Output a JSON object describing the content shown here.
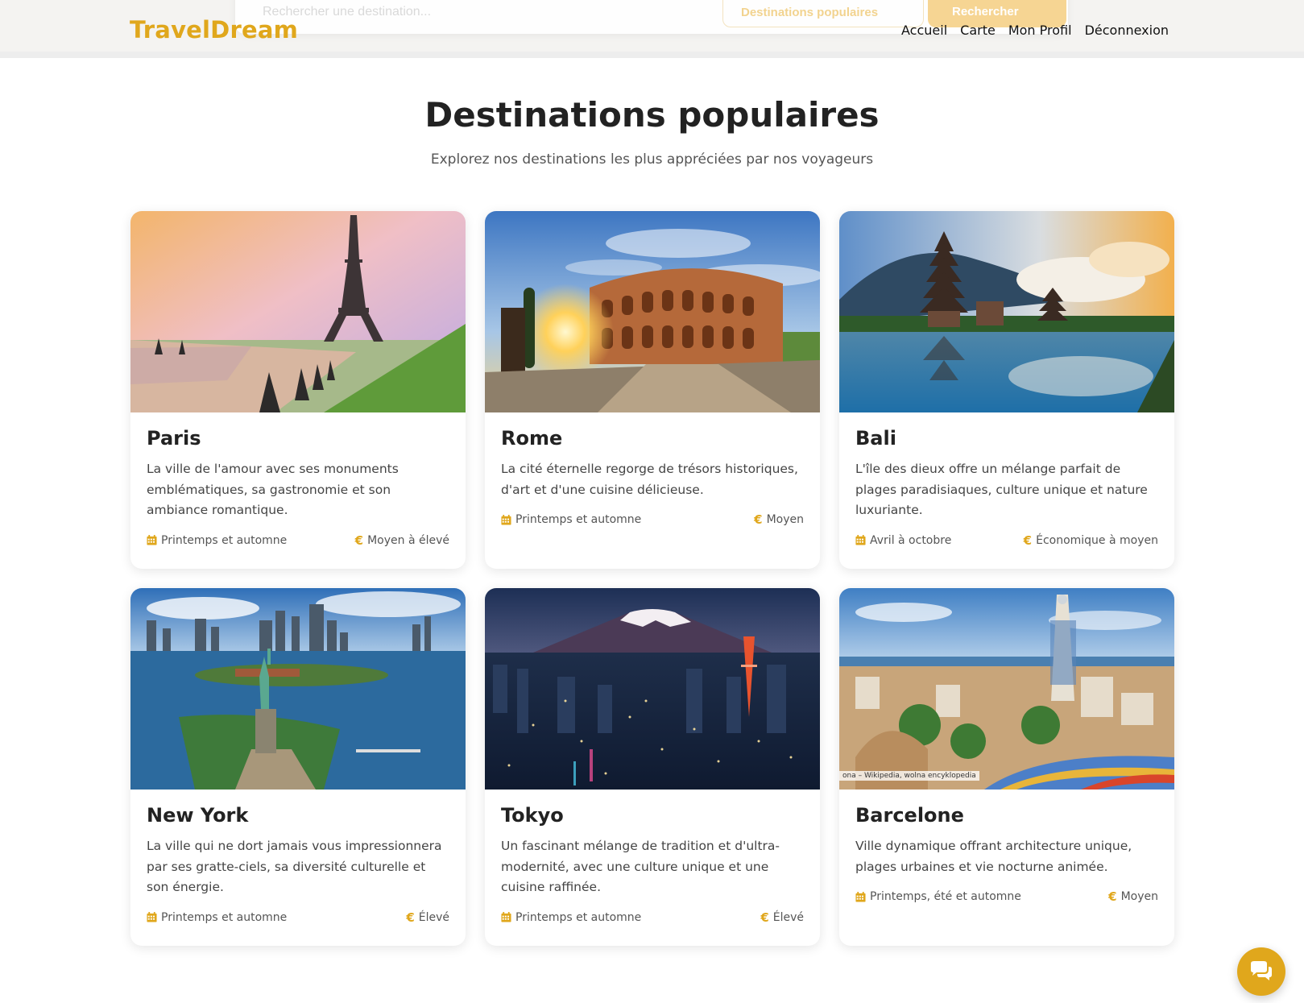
{
  "header": {
    "search_placeholder": "Rechercher une destination...",
    "popular_button_label": "Destinations populaires",
    "search_button_label": "Rechercher",
    "logo": "TravelDream",
    "nav": [
      "Accueil",
      "Carte",
      "Mon Profil",
      "Déconnexion"
    ]
  },
  "section": {
    "title": "Destinations populaires",
    "subtitle": "Explorez nos destinations les plus appréciées par nos voyageurs"
  },
  "cards": [
    {
      "name": "Paris",
      "description": "La ville de l'amour avec ses monuments emblématiques, sa gastronomie et son ambiance romantique.",
      "season": "Printemps et automne",
      "budget": "Moyen à élevé"
    },
    {
      "name": "Rome",
      "description": "La cité éternelle regorge de trésors historiques, d'art et d'une cuisine délicieuse.",
      "season": "Printemps et automne",
      "budget": "Moyen"
    },
    {
      "name": "Bali",
      "description": "L'île des dieux offre un mélange parfait de plages paradisiaques, culture unique et nature luxuriante.",
      "season": "Avril à octobre",
      "budget": "Économique à moyen"
    },
    {
      "name": "New York",
      "description": "La ville qui ne dort jamais vous impressionnera par ses gratte-ciels, sa diversité culturelle et son énergie.",
      "season": "Printemps et automne",
      "budget": "Élevé"
    },
    {
      "name": "Tokyo",
      "description": "Un fascinant mélange de tradition et d'ultra-modernité, avec une culture unique et une cuisine raffinée.",
      "season": "Printemps et automne",
      "budget": "Élevé"
    },
    {
      "name": "Barcelone",
      "description": "Ville dynamique offrant architecture unique, plages urbaines et vie nocturne animée.",
      "season": "Printemps, été et automne",
      "budget": "Moyen",
      "image_credit": "ona – Wikipedia, wolna encyklopedia"
    }
  ],
  "icons": {
    "calendar": "calendar-icon",
    "euro": "€",
    "chat": "chat-icon"
  },
  "colors": {
    "accent": "#e0a71c",
    "text": "#222222",
    "muted": "#555555"
  }
}
